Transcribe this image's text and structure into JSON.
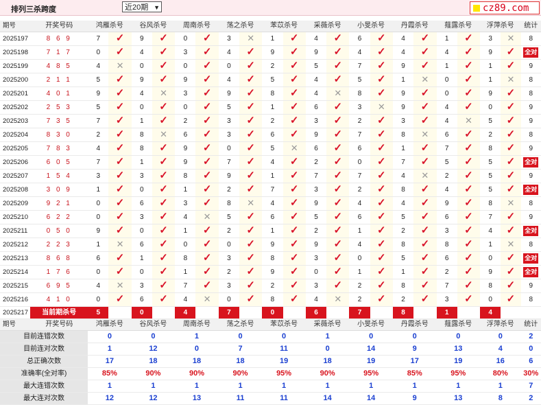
{
  "header": {
    "title": "排列三杀跨度",
    "period_select": "近20期",
    "logo": "cz89.com"
  },
  "columns": {
    "period": "期号",
    "numbers": "开奖号码",
    "methods": [
      "鸿雁杀号",
      "谷风杀号",
      "周南杀号",
      "荡之杀号",
      "苯苡杀号",
      "采薇杀号",
      "小旻杀号",
      "丹霞杀号",
      "薤露杀号",
      "浮萍杀号"
    ],
    "count": "统计"
  },
  "rows": [
    {
      "p": "2025197",
      "n": "869",
      "v": [
        [
          7,
          1
        ],
        [
          9,
          1
        ],
        [
          0,
          1
        ],
        [
          3,
          0
        ],
        [
          1,
          1
        ],
        [
          4,
          1
        ],
        [
          6,
          1
        ],
        [
          4,
          1
        ],
        [
          1,
          1
        ],
        [
          3,
          0
        ]
      ],
      "c": "8"
    },
    {
      "p": "2025198",
      "n": "717",
      "v": [
        [
          0,
          1
        ],
        [
          4,
          1
        ],
        [
          3,
          1
        ],
        [
          4,
          1
        ],
        [
          9,
          1
        ],
        [
          9,
          1
        ],
        [
          4,
          1
        ],
        [
          4,
          1
        ],
        [
          4,
          1
        ],
        [
          9,
          1
        ]
      ],
      "c": "全对"
    },
    {
      "p": "2025199",
      "n": "485",
      "v": [
        [
          4,
          0
        ],
        [
          0,
          1
        ],
        [
          0,
          1
        ],
        [
          0,
          1
        ],
        [
          2,
          1
        ],
        [
          5,
          1
        ],
        [
          7,
          1
        ],
        [
          9,
          1
        ],
        [
          1,
          1
        ],
        [
          1,
          1
        ]
      ],
      "c": "9"
    },
    {
      "p": "2025200",
      "n": "211",
      "v": [
        [
          5,
          1
        ],
        [
          9,
          1
        ],
        [
          9,
          1
        ],
        [
          4,
          1
        ],
        [
          5,
          1
        ],
        [
          4,
          1
        ],
        [
          5,
          1
        ],
        [
          1,
          0
        ],
        [
          0,
          1
        ],
        [
          1,
          0
        ]
      ],
      "c": "8"
    },
    {
      "p": "2025201",
      "n": "401",
      "v": [
        [
          9,
          1
        ],
        [
          4,
          0
        ],
        [
          3,
          1
        ],
        [
          9,
          1
        ],
        [
          8,
          1
        ],
        [
          4,
          0
        ],
        [
          8,
          1
        ],
        [
          9,
          1
        ],
        [
          0,
          1
        ],
        [
          9,
          1
        ]
      ],
      "c": "8"
    },
    {
      "p": "2025202",
      "n": "253",
      "v": [
        [
          5,
          1
        ],
        [
          0,
          1
        ],
        [
          0,
          1
        ],
        [
          5,
          1
        ],
        [
          1,
          1
        ],
        [
          6,
          1
        ],
        [
          3,
          0
        ],
        [
          9,
          1
        ],
        [
          4,
          1
        ],
        [
          0,
          1
        ]
      ],
      "c": "9"
    },
    {
      "p": "2025203",
      "n": "735",
      "v": [
        [
          7,
          1
        ],
        [
          1,
          1
        ],
        [
          2,
          1
        ],
        [
          3,
          1
        ],
        [
          2,
          1
        ],
        [
          3,
          1
        ],
        [
          2,
          1
        ],
        [
          3,
          1
        ],
        [
          4,
          0
        ],
        [
          5,
          1
        ]
      ],
      "c": "9"
    },
    {
      "p": "2025204",
      "n": "830",
      "v": [
        [
          2,
          1
        ],
        [
          8,
          0
        ],
        [
          6,
          1
        ],
        [
          3,
          1
        ],
        [
          6,
          1
        ],
        [
          9,
          1
        ],
        [
          7,
          1
        ],
        [
          8,
          0
        ],
        [
          6,
          1
        ],
        [
          2,
          1
        ]
      ],
      "c": "8"
    },
    {
      "p": "2025205",
      "n": "783",
      "v": [
        [
          4,
          1
        ],
        [
          8,
          1
        ],
        [
          9,
          1
        ],
        [
          0,
          1
        ],
        [
          5,
          0
        ],
        [
          6,
          1
        ],
        [
          6,
          1
        ],
        [
          1,
          1
        ],
        [
          7,
          1
        ],
        [
          8,
          1
        ]
      ],
      "c": "9"
    },
    {
      "p": "2025206",
      "n": "605",
      "v": [
        [
          7,
          1
        ],
        [
          1,
          1
        ],
        [
          9,
          1
        ],
        [
          7,
          1
        ],
        [
          4,
          1
        ],
        [
          2,
          1
        ],
        [
          0,
          1
        ],
        [
          7,
          1
        ],
        [
          5,
          1
        ],
        [
          5,
          1
        ]
      ],
      "c": "全对"
    },
    {
      "p": "2025207",
      "n": "154",
      "v": [
        [
          3,
          1
        ],
        [
          3,
          1
        ],
        [
          8,
          1
        ],
        [
          9,
          1
        ],
        [
          1,
          1
        ],
        [
          7,
          1
        ],
        [
          7,
          1
        ],
        [
          4,
          0
        ],
        [
          2,
          1
        ],
        [
          5,
          1
        ]
      ],
      "c": "9"
    },
    {
      "p": "2025208",
      "n": "309",
      "v": [
        [
          1,
          1
        ],
        [
          0,
          1
        ],
        [
          1,
          1
        ],
        [
          2,
          1
        ],
        [
          7,
          1
        ],
        [
          3,
          1
        ],
        [
          2,
          1
        ],
        [
          8,
          1
        ],
        [
          4,
          1
        ],
        [
          5,
          1
        ]
      ],
      "c": "全对"
    },
    {
      "p": "2025209",
      "n": "921",
      "v": [
        [
          0,
          1
        ],
        [
          6,
          1
        ],
        [
          3,
          1
        ],
        [
          8,
          0
        ],
        [
          4,
          1
        ],
        [
          9,
          1
        ],
        [
          4,
          1
        ],
        [
          4,
          1
        ],
        [
          9,
          1
        ],
        [
          8,
          0
        ]
      ],
      "c": "8"
    },
    {
      "p": "2025210",
      "n": "622",
      "v": [
        [
          0,
          1
        ],
        [
          3,
          1
        ],
        [
          4,
          0
        ],
        [
          5,
          1
        ],
        [
          6,
          1
        ],
        [
          5,
          1
        ],
        [
          6,
          1
        ],
        [
          5,
          1
        ],
        [
          6,
          1
        ],
        [
          7,
          1
        ]
      ],
      "c": "9"
    },
    {
      "p": "2025211",
      "n": "050",
      "v": [
        [
          9,
          1
        ],
        [
          0,
          1
        ],
        [
          1,
          1
        ],
        [
          2,
          1
        ],
        [
          1,
          1
        ],
        [
          2,
          1
        ],
        [
          1,
          1
        ],
        [
          2,
          1
        ],
        [
          3,
          1
        ],
        [
          4,
          1
        ]
      ],
      "c": "全对"
    },
    {
      "p": "2025212",
      "n": "223",
      "v": [
        [
          1,
          0
        ],
        [
          6,
          1
        ],
        [
          0,
          1
        ],
        [
          0,
          1
        ],
        [
          9,
          1
        ],
        [
          9,
          1
        ],
        [
          4,
          1
        ],
        [
          8,
          1
        ],
        [
          8,
          1
        ],
        [
          1,
          0
        ]
      ],
      "c": "8"
    },
    {
      "p": "2025213",
      "n": "868",
      "v": [
        [
          6,
          1
        ],
        [
          1,
          1
        ],
        [
          8,
          1
        ],
        [
          3,
          1
        ],
        [
          8,
          1
        ],
        [
          3,
          1
        ],
        [
          0,
          1
        ],
        [
          5,
          1
        ],
        [
          6,
          1
        ],
        [
          0,
          1
        ]
      ],
      "c": "全对"
    },
    {
      "p": "2025214",
      "n": "176",
      "v": [
        [
          0,
          1
        ],
        [
          0,
          1
        ],
        [
          1,
          1
        ],
        [
          2,
          1
        ],
        [
          9,
          1
        ],
        [
          0,
          1
        ],
        [
          1,
          1
        ],
        [
          1,
          1
        ],
        [
          2,
          1
        ],
        [
          9,
          1
        ]
      ],
      "c": "全对"
    },
    {
      "p": "2025215",
      "n": "695",
      "v": [
        [
          4,
          0
        ],
        [
          3,
          1
        ],
        [
          7,
          1
        ],
        [
          3,
          1
        ],
        [
          2,
          1
        ],
        [
          3,
          1
        ],
        [
          2,
          1
        ],
        [
          8,
          1
        ],
        [
          7,
          1
        ],
        [
          8,
          1
        ]
      ],
      "c": "9"
    },
    {
      "p": "2025216",
      "n": "410",
      "v": [
        [
          0,
          1
        ],
        [
          6,
          1
        ],
        [
          4,
          0
        ],
        [
          0,
          1
        ],
        [
          8,
          1
        ],
        [
          4,
          0
        ],
        [
          2,
          1
        ],
        [
          2,
          1
        ],
        [
          3,
          1
        ],
        [
          0,
          1
        ]
      ],
      "c": "8"
    }
  ],
  "current": {
    "p": "2025217",
    "label": "当前期杀号",
    "vals": [
      "5",
      "0",
      "4",
      "7",
      "0",
      "6",
      "7",
      "8",
      "1",
      "4"
    ]
  },
  "stats": [
    {
      "label": "目前连错次数",
      "vals": [
        "0",
        "0",
        "1",
        "0",
        "0",
        "1",
        "0",
        "0",
        "0",
        "0"
      ],
      "c": "2",
      "cls": "sv"
    },
    {
      "label": "目前连对次数",
      "vals": [
        "1",
        "12",
        "0",
        "7",
        "11",
        "0",
        "14",
        "9",
        "13",
        "4"
      ],
      "c": "0",
      "cls": "sv"
    },
    {
      "label": "总正确次数",
      "vals": [
        "17",
        "18",
        "18",
        "18",
        "19",
        "18",
        "19",
        "17",
        "19",
        "16"
      ],
      "c": "6",
      "cls": "sv"
    },
    {
      "label": "准确率(全对率)",
      "vals": [
        "85%",
        "90%",
        "90%",
        "90%",
        "95%",
        "90%",
        "95%",
        "85%",
        "95%",
        "80%"
      ],
      "c": "30%",
      "cls": "acc"
    },
    {
      "label": "最大连错次数",
      "vals": [
        "1",
        "1",
        "1",
        "1",
        "1",
        "1",
        "1",
        "1",
        "1",
        "1"
      ],
      "c": "7",
      "cls": "sv"
    },
    {
      "label": "最大连对次数",
      "vals": [
        "12",
        "12",
        "13",
        "11",
        "11",
        "14",
        "14",
        "9",
        "13",
        "8"
      ],
      "c": "2",
      "cls": "sv"
    }
  ],
  "icons": {
    "correct": "check-mark-icon",
    "wrong": "cross-mark-icon"
  },
  "colors": {
    "accent": "#d8141e",
    "stat": "#1a3fd1",
    "header_bg": "#fdecef"
  }
}
